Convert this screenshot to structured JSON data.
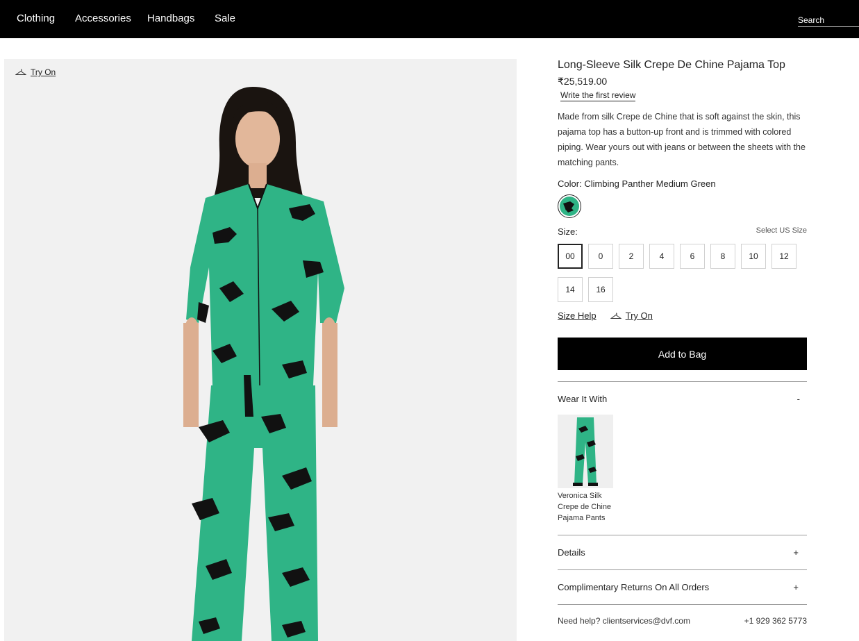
{
  "nav": {
    "items": [
      {
        "label": "Clothing"
      },
      {
        "label": "Accessories"
      },
      {
        "label": "Handbags"
      },
      {
        "label": "Sale"
      }
    ],
    "search_placeholder": "Search"
  },
  "hero": {
    "try_on_label": "Try On",
    "hanger_icon": "hanger-icon"
  },
  "product": {
    "title": "Long-Sleeve Silk Crepe De Chine Pajama Top",
    "price": "₹25,519.00",
    "review_link": "Write the first review",
    "description": "Made from silk Crepe de Chine that is soft against the skin, this pajama top has a button-up front and is trimmed with colored piping. Wear yours out with jeans or between the sheets with the matching pants.",
    "color_label": "Color:",
    "color_value": "Climbing Panther Medium Green",
    "swatch_color": "#2fb486",
    "size_label": "Size:",
    "size_system": "Select US Size",
    "sizes": [
      "00",
      "0",
      "2",
      "4",
      "6",
      "8",
      "10",
      "12",
      "14",
      "16"
    ],
    "selected_size": "00",
    "size_help": "Size Help",
    "try_on_label": "Try On",
    "add_to_bag": "Add to Bag"
  },
  "wear_it_with": {
    "label": "Wear It With",
    "toggle": "-",
    "item_name": "Veronica Silk Crepe de Chine Pajama Pants"
  },
  "accordions": [
    {
      "label": "Details",
      "toggle": "+"
    },
    {
      "label": "Complimentary Returns On All Orders",
      "toggle": "+"
    }
  ],
  "help": {
    "text": "Need help? clientservices@dvf.com",
    "phone": "+1 929 362 5773"
  },
  "colors": {
    "nav_bg": "#000000",
    "garment_green": "#2fb486",
    "button_bg": "#000000"
  }
}
